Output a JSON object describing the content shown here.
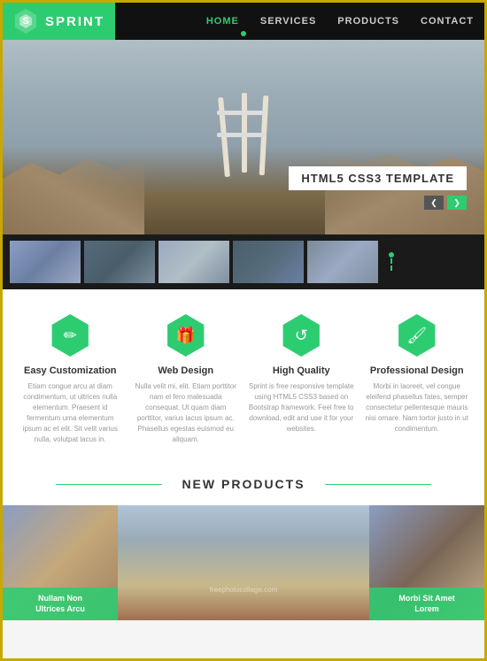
{
  "navbar": {
    "brand": "SPRINT",
    "brand_letter": "S",
    "links": [
      {
        "label": "HOME",
        "active": true
      },
      {
        "label": "SERVICES",
        "active": false
      },
      {
        "label": "PRODUCTS",
        "active": false
      },
      {
        "label": "CONTACT",
        "active": false
      }
    ]
  },
  "hero": {
    "label": "HTML5 CSS3 TEMPLATE",
    "prev_arrow": "❮",
    "next_arrow": "❯"
  },
  "features": [
    {
      "icon": "✏",
      "title": "Easy Customization",
      "text": "Etiam congue arcu at diam condimentum, ut ultrices nulla elementum. Praesent id fermentum urna elementum ipsum ac et elit. Sit velit varius nulla, volutpat lacus in."
    },
    {
      "icon": "🎁",
      "title": "Web Design",
      "text": "Nulla velit mi, elit. Etiam porttitor nam el fero malesuada consequat. Ut quam diam porttitor, varius lacus ipsum ac. Phasellus egestas euismod eu aliquam."
    },
    {
      "icon": "↺",
      "title": "High Quality",
      "text": "Sprint is free responsive template using HTML5 CSS3 based on Bootstrap framework. Feel free to download, edit and use it for your websites."
    },
    {
      "icon": "🖌",
      "title": "Professional Design",
      "text": "Morbi in laoreet, vel congue eleifend phasellus fates, semper consectetur pellentesque mauris nisi ornare. Nam tortor justo in ut condimentum."
    }
  ],
  "new_products": {
    "title": "NEW PRODUCTS",
    "products": [
      {
        "label_line1": "Nullam Non",
        "label_line2": "Ultrices Arcu"
      },
      {
        "label_line1": "",
        "label_line2": ""
      },
      {
        "label_line1": "Morbi Sit Amet",
        "label_line2": "Lorem"
      }
    ]
  }
}
